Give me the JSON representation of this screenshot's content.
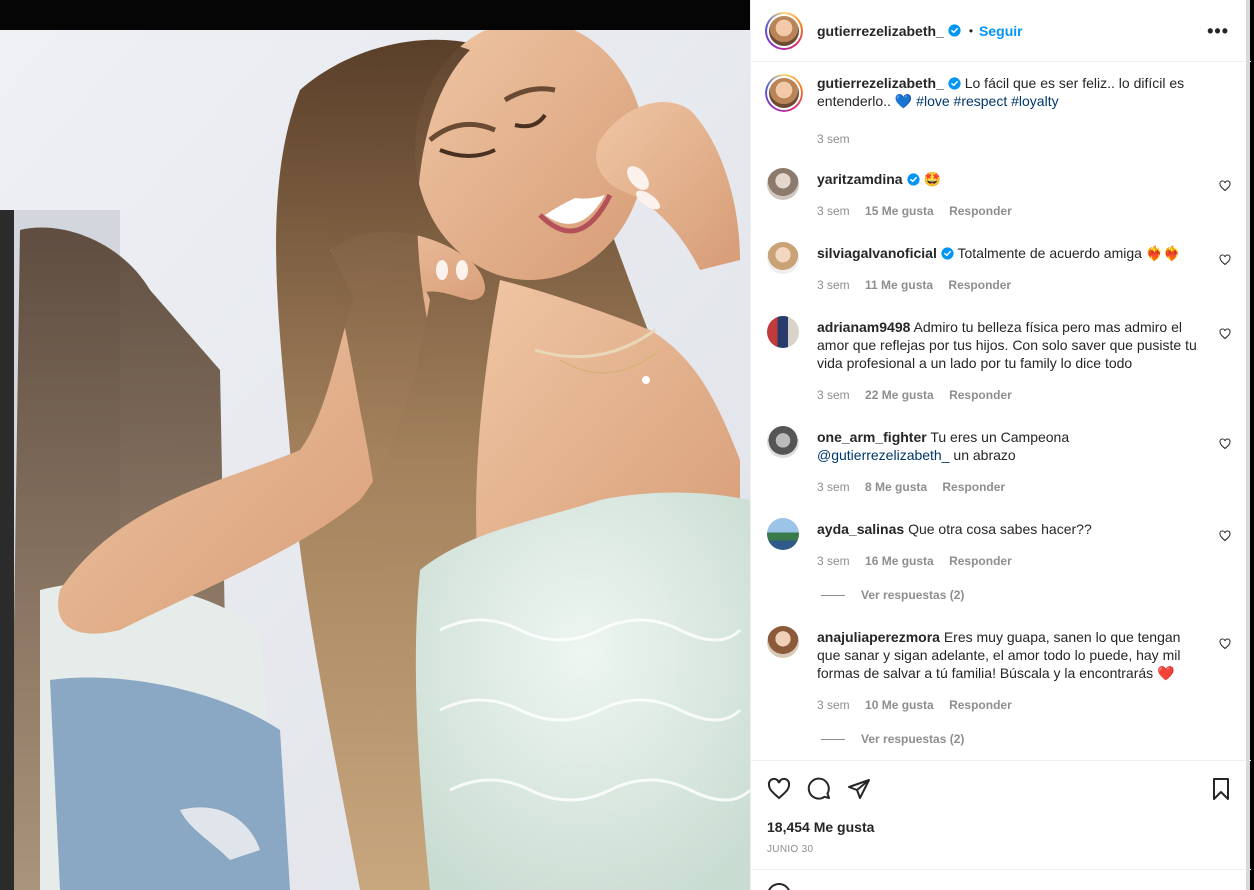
{
  "post": {
    "username": "gutierrezelizabeth_",
    "follow_label": "Seguir",
    "dot": "•",
    "more_label": "•••",
    "caption_text": "Lo fácil que es ser feliz.. lo difícil es entenderlo..",
    "caption_emoji": "💙",
    "hashtags": [
      "#love",
      "#respect",
      "#loyalty"
    ],
    "caption_time": "3 sem"
  },
  "comments": [
    {
      "user": "yaritzamdina",
      "verified": true,
      "text": "🤩",
      "time": "3 sem",
      "likes": "15 Me gusta",
      "reply": "Responder"
    },
    {
      "user": "silviagalvanoficial",
      "verified": true,
      "text": "Totalmente de acuerdo amiga ❤️‍🔥❤️‍🔥",
      "time": "3 sem",
      "likes": "11 Me gusta",
      "reply": "Responder"
    },
    {
      "user": "adrianam9498",
      "verified": false,
      "text": "Admiro tu belleza física pero mas admiro el amor que reflejas por tus hijos. Con solo saver que pusiste tu vida profesional a un lado por tu family lo dice todo",
      "time": "3 sem",
      "likes": "22 Me gusta",
      "reply": "Responder"
    },
    {
      "user": "one_arm_fighter",
      "verified": false,
      "text_before": "Tu eres un Campeona",
      "mention": "@gutierrezelizabeth_",
      "text_after": "un abrazo",
      "time": "3 sem",
      "likes": "8 Me gusta",
      "reply": "Responder"
    },
    {
      "user": "ayda_salinas",
      "verified": false,
      "text": "Que otra cosa sabes hacer??",
      "time": "3 sem",
      "likes": "16 Me gusta",
      "reply": "Responder",
      "view_replies": "Ver respuestas (2)"
    },
    {
      "user": "anajuliaperezmora",
      "verified": false,
      "text": "Eres muy guapa, sanen lo que tengan que sanar y sigan adelante, el amor todo lo puede, hay mil formas de salvar a tú familia! Búscala y la encontrarás ❤️",
      "time": "3 sem",
      "likes": "10 Me gusta",
      "reply": "Responder",
      "view_replies": "Ver respuestas (2)"
    }
  ],
  "footer": {
    "likes": "18,454 Me gusta",
    "date": "JUNIO 30"
  },
  "colors": {
    "accent": "#0095f6",
    "hashtag": "#00376b",
    "muted": "#8e8e8e",
    "verified": "#0095f6"
  },
  "icons": [
    "verified-badge-icon",
    "more-options-icon",
    "heart-icon",
    "comment-icon",
    "share-icon",
    "bookmark-icon",
    "emoji-icon"
  ]
}
